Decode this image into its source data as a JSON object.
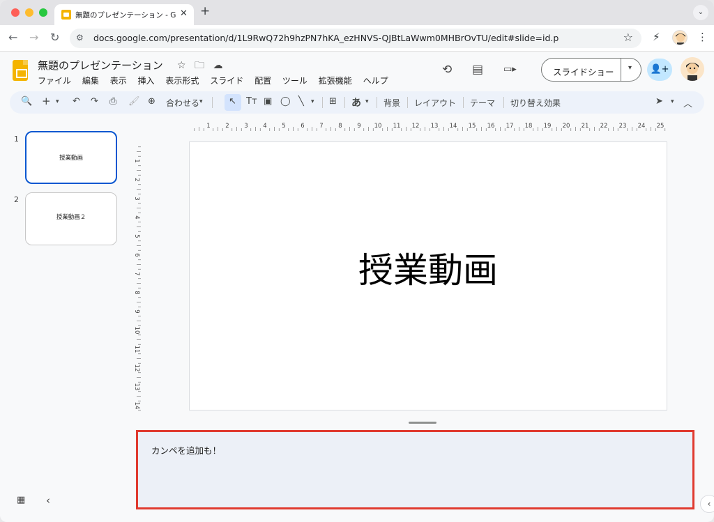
{
  "browser": {
    "tab_title": "無題のプレゼンテーション - Goo",
    "tab_close": "✕",
    "new_tab": "+",
    "tab_search": "⌄",
    "url": "docs.google.com/presentation/d/1L9RwQ72h9hzPN7hKA_ezHNVS-QJBtLaWwm0MHBrOvTU/edit#slide=id.p",
    "back": "←",
    "forward": "→",
    "reload": "↻",
    "site_info": "⚙",
    "bookmark": "☆",
    "extension": "⚡",
    "menu": "⋮"
  },
  "app": {
    "title": "無題のプレゼンテーション",
    "star": "☆",
    "move": "🗀",
    "cloud": "☁",
    "menu": [
      "ファイル",
      "編集",
      "表示",
      "挿入",
      "表示形式",
      "スライド",
      "配置",
      "ツール",
      "拡張機能",
      "ヘルプ"
    ],
    "history_icon": "⟲",
    "comments_icon": "▤",
    "meet_icon": "▭▸",
    "slideshow_label": "スライドショー",
    "slideshow_caret": "▾",
    "share_icon": "👤+"
  },
  "toolbar": {
    "search": "🔍",
    "add": "+",
    "add_caret": "▾",
    "undo": "↶",
    "redo": "↷",
    "print": "⎙",
    "paint_format": "🖌",
    "zoom": "⊕",
    "zoom_value": "合わせる",
    "zoom_caret": "▾",
    "select": "↖",
    "textbox": "Tт",
    "image": "▣",
    "shapes": "◯",
    "line": "╲",
    "line_caret": "▾",
    "comment": "⊞",
    "input_tools": "あ",
    "input_caret": "▾",
    "background": "背景",
    "layout": "レイアウト",
    "theme": "テーマ",
    "transition": "切り替え効果",
    "pointer": "➤",
    "pointer_caret": "▾",
    "collapse": "︿"
  },
  "slides": [
    {
      "number": "1",
      "title": "授業動画"
    },
    {
      "number": "2",
      "title": "授業動画２"
    }
  ],
  "filmstrip": {
    "grid_icon": "▦",
    "collapse_icon": "‹"
  },
  "ruler": {
    "top_labels": [
      "1",
      "2",
      "3",
      "4",
      "5",
      "6",
      "7",
      "8",
      "9",
      "10",
      "11",
      "12",
      "13",
      "14",
      "15",
      "16",
      "17",
      "18",
      "19",
      "20",
      "21",
      "22",
      "23",
      "24",
      "25"
    ],
    "left_labels": [
      "1",
      "2",
      "3",
      "4",
      "5",
      "6",
      "7",
      "8",
      "9",
      "10",
      "11",
      "12",
      "13",
      "14"
    ]
  },
  "canvas": {
    "slide_title": "授業動画"
  },
  "notes": {
    "text": "カンペを追加も！",
    "side_toggle": "‹"
  }
}
